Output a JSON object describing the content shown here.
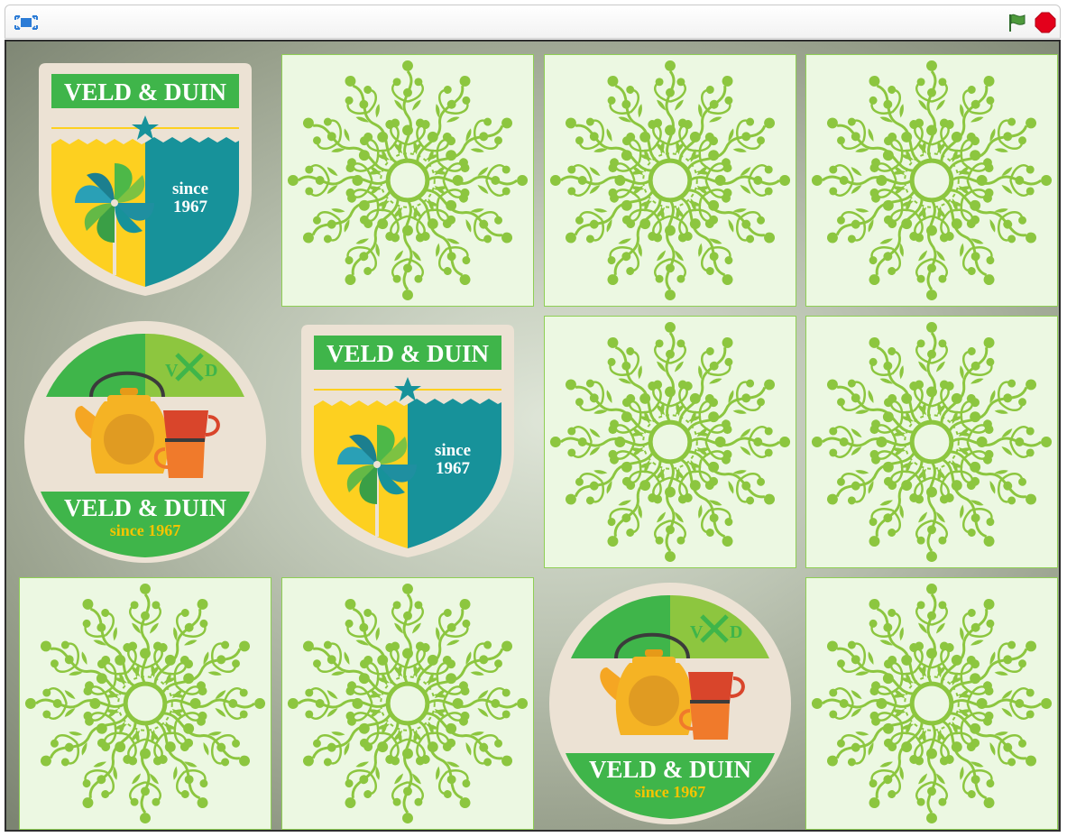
{
  "toolbar": {
    "fullscreen_icon": "fullscreen-icon",
    "green_flag_icon": "green-flag-icon",
    "stop_icon": "stop-sign-icon"
  },
  "brand": {
    "name": "VELD & DUIN",
    "since_word": "since",
    "since_year": "1967",
    "since_full": "since 1967",
    "monogram_left": "V",
    "monogram_right": "D"
  },
  "cards": [
    {
      "row": 1,
      "col": 1,
      "state": "revealed",
      "face": "shield-badge"
    },
    {
      "row": 1,
      "col": 2,
      "state": "hidden"
    },
    {
      "row": 1,
      "col": 3,
      "state": "hidden"
    },
    {
      "row": 1,
      "col": 4,
      "state": "hidden"
    },
    {
      "row": 2,
      "col": 1,
      "state": "revealed",
      "face": "round-teapot-badge"
    },
    {
      "row": 2,
      "col": 2,
      "state": "revealed",
      "face": "shield-badge"
    },
    {
      "row": 2,
      "col": 3,
      "state": "hidden"
    },
    {
      "row": 2,
      "col": 4,
      "state": "hidden"
    },
    {
      "row": 3,
      "col": 1,
      "state": "hidden"
    },
    {
      "row": 3,
      "col": 2,
      "state": "hidden"
    },
    {
      "row": 3,
      "col": 3,
      "state": "revealed",
      "face": "round-teapot-badge"
    },
    {
      "row": 3,
      "col": 4,
      "state": "hidden"
    }
  ],
  "colors": {
    "card_back_bg": "#ecf8e2",
    "ornament": "#8cc63f",
    "badge_green": "#3fb54a",
    "badge_teal": "#17929a",
    "badge_yellow": "#fdd020",
    "badge_cream": "#ece2d4",
    "year_text": "#f5c400"
  }
}
